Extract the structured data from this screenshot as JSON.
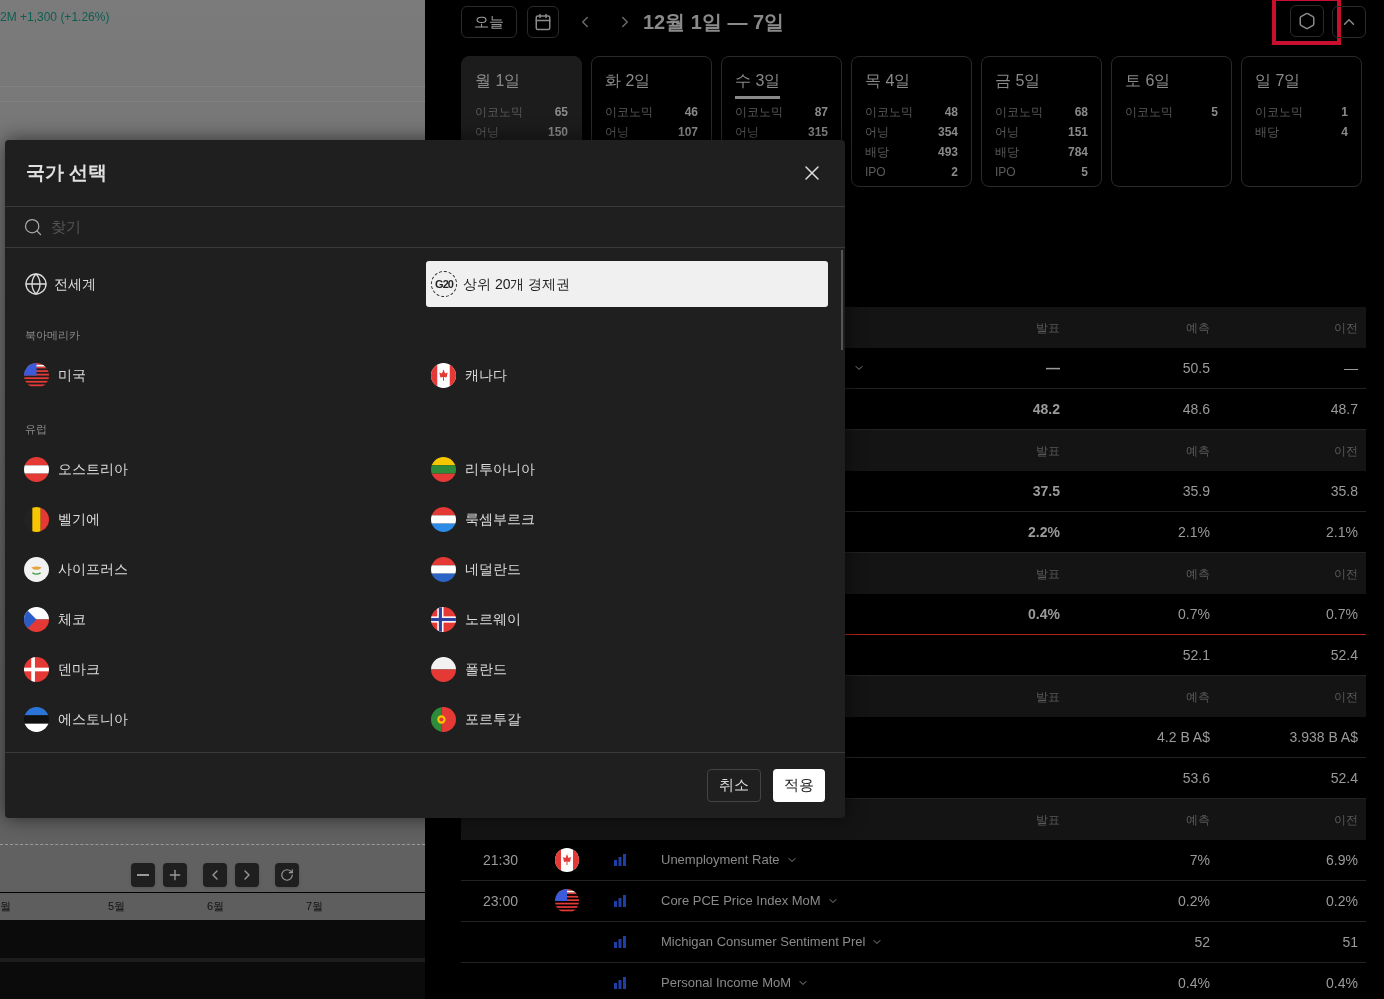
{
  "chart_panel": {
    "quote": "2M +1,300 (+1.26%)",
    "axis_labels": [
      "월",
      "5월",
      "6월",
      "7월"
    ]
  },
  "toolbar": {
    "today_button": "오늘",
    "range_title": "12월 1일 — 7일"
  },
  "days": [
    {
      "label": "월 1일",
      "selected": true,
      "today": false,
      "stats": [
        {
          "label": "이코노믹",
          "value": "65"
        },
        {
          "label": "어닝",
          "value": "150"
        }
      ]
    },
    {
      "label": "화 2일",
      "selected": false,
      "today": false,
      "stats": [
        {
          "label": "이코노믹",
          "value": "46"
        },
        {
          "label": "어닝",
          "value": "107"
        }
      ]
    },
    {
      "label": "수 3일",
      "selected": false,
      "today": true,
      "stats": [
        {
          "label": "이코노믹",
          "value": "87"
        },
        {
          "label": "어닝",
          "value": "315"
        }
      ]
    },
    {
      "label": "목 4일",
      "selected": false,
      "today": false,
      "stats": [
        {
          "label": "이코노믹",
          "value": "48"
        },
        {
          "label": "어닝",
          "value": "354"
        },
        {
          "label": "배당",
          "value": "493"
        },
        {
          "label": "IPO",
          "value": "2"
        }
      ]
    },
    {
      "label": "금 5일",
      "selected": false,
      "today": false,
      "stats": [
        {
          "label": "이코노믹",
          "value": "68"
        },
        {
          "label": "어닝",
          "value": "151"
        },
        {
          "label": "배당",
          "value": "784"
        },
        {
          "label": "IPO",
          "value": "5"
        }
      ]
    },
    {
      "label": "토 6일",
      "selected": false,
      "today": false,
      "stats": [
        {
          "label": "이코노믹",
          "value": "5"
        }
      ]
    },
    {
      "label": "일 7일",
      "selected": false,
      "today": false,
      "stats": [
        {
          "label": "이코노믹",
          "value": "1"
        },
        {
          "label": "배당",
          "value": "4"
        }
      ]
    }
  ],
  "table": {
    "rows": [
      {
        "kind": "header",
        "columns": [
          "발표",
          "예측",
          "이전"
        ]
      },
      {
        "kind": "event",
        "chevron": true,
        "actual": "—",
        "forecast": "50.5",
        "previous": "—"
      },
      {
        "kind": "event",
        "chevron": false,
        "actual": "48.2",
        "forecast": "48.6",
        "previous": "48.7"
      },
      {
        "kind": "header",
        "columns": [
          "발표",
          "예측",
          "이전"
        ]
      },
      {
        "kind": "event",
        "chevron": false,
        "actual": "37.5",
        "forecast": "35.9",
        "previous": "35.8"
      },
      {
        "kind": "event",
        "chevron": false,
        "actual": "2.2%",
        "forecast": "2.1%",
        "previous": "2.1%"
      },
      {
        "kind": "header",
        "columns": [
          "발표",
          "예측",
          "이전"
        ]
      },
      {
        "kind": "event",
        "chevron": false,
        "actual": "0.4%",
        "forecast": "0.7%",
        "previous": "0.7%"
      },
      {
        "kind": "now-line"
      },
      {
        "kind": "event",
        "chevron": false,
        "forecast": "52.1",
        "previous": "52.4"
      },
      {
        "kind": "header",
        "columns": [
          "발표",
          "예측",
          "이전"
        ]
      },
      {
        "kind": "event",
        "chevron": false,
        "forecast": "4.2 B A$",
        "previous": "3.938 B A$"
      },
      {
        "kind": "event",
        "chevron": false,
        "forecast": "53.6",
        "previous": "52.4"
      },
      {
        "kind": "header",
        "columns": [
          "발표",
          "예측",
          "이전"
        ]
      },
      {
        "kind": "event",
        "chevron": true,
        "time": "21:30",
        "country": {
          "kind": "ca"
        },
        "name": "Unemployment Rate",
        "forecast": "7%",
        "previous": "6.9%"
      },
      {
        "kind": "event",
        "chevron": true,
        "time": "23:00",
        "country": {
          "kind": "us"
        },
        "name": "Core PCE Price Index MoM",
        "forecast": "0.2%",
        "previous": "0.2%"
      },
      {
        "kind": "event",
        "chevron": true,
        "name": "Michigan Consumer Sentiment Prel",
        "forecast": "52",
        "previous": "51"
      },
      {
        "kind": "event",
        "chevron": true,
        "name": "Personal Income MoM",
        "forecast": "0.4%",
        "previous": "0.4%"
      }
    ]
  },
  "dialog": {
    "title": "국가 선택",
    "search": {
      "placeholder": "찾기"
    },
    "top_items": [
      {
        "kind": "world",
        "label": "전세계",
        "selected": false
      },
      {
        "kind": "g20",
        "badge": "G20",
        "label": "상위 20개 경제권",
        "selected": true
      }
    ],
    "regions": [
      {
        "title": "북아메리카",
        "countries": [
          {
            "flag": {
              "kind": "us"
            },
            "name": "미국",
            "selected": false
          },
          {
            "flag": {
              "kind": "ca"
            },
            "name": "캐나다",
            "selected": false
          }
        ]
      },
      {
        "title": "유럽",
        "countries": [
          {
            "flag": {
              "kind": "at"
            },
            "name": "오스트리아",
            "selected": false
          },
          {
            "flag": {
              "kind": "lt"
            },
            "name": "리투아니아",
            "selected": false
          },
          {
            "flag": {
              "kind": "be"
            },
            "name": "벨기에",
            "selected": false
          },
          {
            "flag": {
              "kind": "lu"
            },
            "name": "룩셈부르크",
            "selected": false
          },
          {
            "flag": {
              "kind": "cy"
            },
            "name": "사이프러스",
            "selected": false
          },
          {
            "flag": {
              "kind": "nl"
            },
            "name": "네덜란드",
            "selected": false
          },
          {
            "flag": {
              "kind": "cz"
            },
            "name": "체코",
            "selected": false
          },
          {
            "flag": {
              "kind": "no"
            },
            "name": "노르웨이",
            "selected": false
          },
          {
            "flag": {
              "kind": "dk"
            },
            "name": "덴마크",
            "selected": false
          },
          {
            "flag": {
              "kind": "pl"
            },
            "name": "폴란드",
            "selected": false
          },
          {
            "flag": {
              "kind": "ee"
            },
            "name": "에스토니아",
            "selected": false
          },
          {
            "flag": {
              "kind": "pt"
            },
            "name": "포르투갈",
            "selected": false
          }
        ]
      }
    ],
    "cancel_button": "취소",
    "apply_button": "적용"
  }
}
